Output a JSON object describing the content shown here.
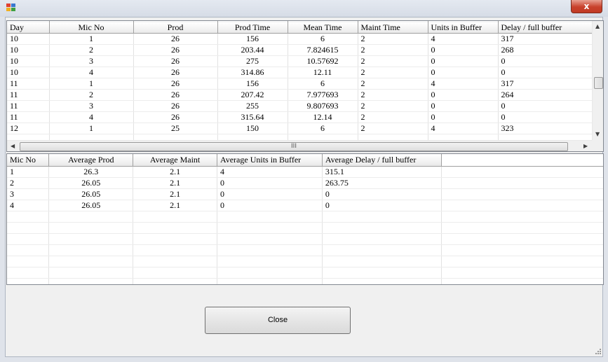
{
  "window": {
    "close_glyph": "x"
  },
  "detail_grid": {
    "columns": [
      "Day",
      "Mic No",
      "Prod",
      "Prod Time",
      "Mean Time",
      "Maint Time",
      "Units in Buffer",
      "Delay / full buffer"
    ],
    "rows": [
      [
        "10",
        "1",
        "26",
        "156",
        "6",
        "2",
        "4",
        "317"
      ],
      [
        "10",
        "2",
        "26",
        "203.44",
        "7.824615",
        "2",
        "0",
        "268"
      ],
      [
        "10",
        "3",
        "26",
        "275",
        "10.57692",
        "2",
        "0",
        "0"
      ],
      [
        "10",
        "4",
        "26",
        "314.86",
        "12.11",
        "2",
        "0",
        "0"
      ],
      [
        "11",
        "1",
        "26",
        "156",
        "6",
        "2",
        "4",
        "317"
      ],
      [
        "11",
        "2",
        "26",
        "207.42",
        "7.977693",
        "2",
        "0",
        "264"
      ],
      [
        "11",
        "3",
        "26",
        "255",
        "9.807693",
        "2",
        "0",
        "0"
      ],
      [
        "11",
        "4",
        "26",
        "315.64",
        "12.14",
        "2",
        "0",
        "0"
      ],
      [
        "12",
        "1",
        "25",
        "150",
        "6",
        "2",
        "4",
        "323"
      ]
    ],
    "horizontal_thumb_glyph": "III"
  },
  "summary_grid": {
    "columns": [
      "Mic No",
      "Average Prod",
      "Average Maint",
      "Average Units in Buffer",
      "Average Delay / full buffer"
    ],
    "rows": [
      [
        "1",
        "26.3",
        "2.1",
        "4",
        "315.1"
      ],
      [
        "2",
        "26.05",
        "2.1",
        "0",
        "263.75"
      ],
      [
        "3",
        "26.05",
        "2.1",
        "0",
        "0"
      ],
      [
        "4",
        "26.05",
        "2.1",
        "0",
        "0"
      ]
    ]
  },
  "footer": {
    "close_label": "Close"
  }
}
